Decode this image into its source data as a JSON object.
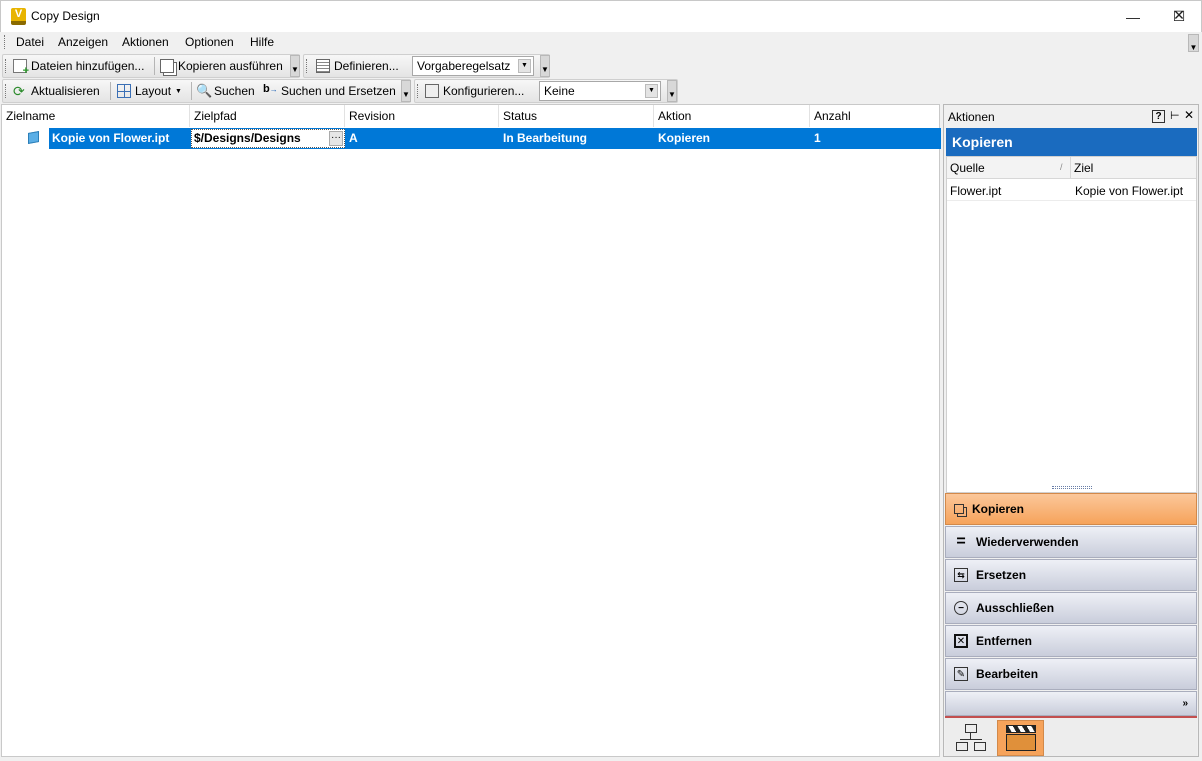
{
  "window": {
    "title": "Copy Design",
    "app_icon": "V"
  },
  "menu": [
    "Datei",
    "Anzeigen",
    "Aktionen",
    "Optionen",
    "Hilfe"
  ],
  "toolbar1": {
    "add_files": "Dateien hinzufügen...",
    "run_copy": "Kopieren ausführen",
    "define": "Definieren...",
    "ruleset": "Vorgaberegelsatz"
  },
  "toolbar2": {
    "refresh": "Aktualisieren",
    "layout": "Layout",
    "search": "Suchen",
    "search_replace": "Suchen und Ersetzen",
    "configure": "Konfigurieren...",
    "filter": "Keine"
  },
  "grid": {
    "columns": [
      "Zielname",
      "Zielpfad",
      "Revision",
      "Status",
      "Aktion",
      "Anzahl"
    ],
    "rows": [
      {
        "name": "Kopie von Flower.ipt",
        "path": "$/Designs/Designs",
        "revision": "A",
        "status": "In Bearbeitung",
        "action": "Kopieren",
        "count": "1",
        "ellipsis": "···"
      }
    ]
  },
  "panel": {
    "header": "Aktionen",
    "title": "Kopieren",
    "columns": [
      "Quelle",
      "Ziel"
    ],
    "rows": [
      {
        "source": "Flower.ipt",
        "target": "Kopie von Flower.ipt"
      }
    ],
    "actions": [
      "Kopieren",
      "Wiederverwenden",
      "Ersetzen",
      "Ausschließen",
      "Entfernen",
      "Bearbeiten"
    ],
    "selected_action": "Kopieren",
    "accent_color": "#f6a35b",
    "title_color": "#1a6bbf"
  },
  "colors": {
    "selection": "#0078d7"
  }
}
